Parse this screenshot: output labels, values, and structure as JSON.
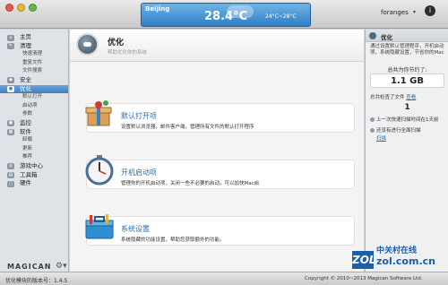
{
  "titlebar": {
    "weather": {
      "city": "Beijing",
      "temp": "28.4°C",
      "range": "24°C~28°C"
    },
    "user": "foranges",
    "user_caret": "▾",
    "app_icon": "i"
  },
  "sidebar": {
    "items": [
      {
        "label": "主页",
        "type": "top",
        "icon": "home-icon",
        "glyph": "⌂"
      },
      {
        "label": "清理",
        "type": "top",
        "icon": "broom-icon",
        "glyph": "✎"
      },
      {
        "label": "快速清理",
        "type": "sub"
      },
      {
        "label": "重复文件",
        "type": "sub"
      },
      {
        "label": "文件搜索",
        "type": "sub"
      },
      {
        "label": "安全",
        "type": "top",
        "icon": "shield-icon",
        "glyph": "◆"
      },
      {
        "label": "优化",
        "type": "top",
        "icon": "rocket-icon",
        "glyph": "●",
        "active": true
      },
      {
        "label": "默认打开",
        "type": "sub"
      },
      {
        "label": "启动项",
        "type": "sub"
      },
      {
        "label": "参数",
        "type": "sub"
      },
      {
        "label": "监控",
        "type": "top",
        "icon": "monitor-icon",
        "glyph": "▣"
      },
      {
        "label": "软件",
        "type": "top",
        "icon": "software-icon",
        "glyph": "▦"
      },
      {
        "label": "卸载",
        "type": "sub"
      },
      {
        "label": "更新",
        "type": "sub"
      },
      {
        "label": "推荐",
        "type": "sub"
      },
      {
        "label": "游戏中心",
        "type": "top",
        "icon": "gamepad-icon",
        "glyph": "◎"
      },
      {
        "label": "工具箱",
        "type": "top",
        "icon": "toolbox-icon",
        "glyph": "▤"
      },
      {
        "label": "硬件",
        "type": "top",
        "icon": "hardware-icon",
        "glyph": "▢"
      }
    ],
    "brand": "MAGICAN",
    "brand_gear": "⚙▾"
  },
  "main": {
    "title": "优化",
    "subtitle": "帮助优化你的系统",
    "cards": [
      {
        "title": "默认打开项",
        "desc": "设置默认浏览器，邮件客户端，管理所有文件的默认打开程序",
        "icon": "gift-box-icon"
      },
      {
        "title": "开机启动项",
        "desc": "管理你的开机启动项，关闭一些不必要的启动，可以加快Mac启",
        "icon": "stopwatch-icon"
      },
      {
        "title": "系统设置",
        "desc": "系统隐藏的功能设置，帮助您获取额外的功能。",
        "icon": "toolbox-icon"
      }
    ]
  },
  "rpanel": {
    "title": "优化",
    "desc": "通过设置默认管理程序，开机启动项，系统隐藏设置，节省你的Mac",
    "saved_label": "总共为你节约了:",
    "saved_value": "1.1 GB",
    "checked_label": "总共检查了文件",
    "checked_link": "查看",
    "checked_count": "1",
    "last_scan": "上一次快速扫描时间在1天前",
    "full_scan_note": "还没有进行全面扫描",
    "scan_link": "扫描"
  },
  "statusbar": {
    "version": "优化模块的版本号：1.4.5",
    "copyright": "Copyright © 2010~2013 Magican Software Ltd."
  },
  "watermark": {
    "top": "中关村在线",
    "bottom": "zol.com.cn",
    "logo": "ZOL"
  }
}
